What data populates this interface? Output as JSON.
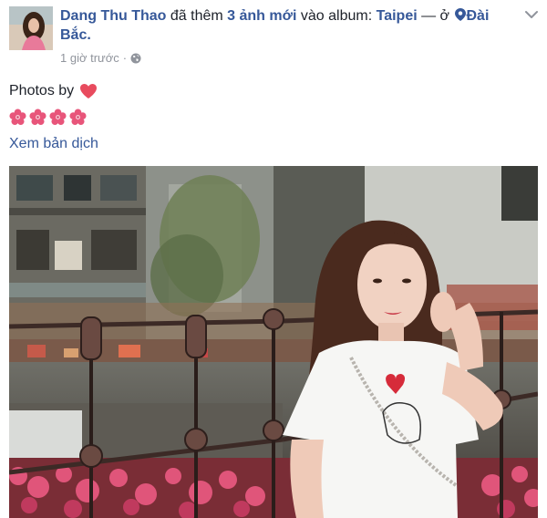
{
  "post": {
    "author": "Dang Thu Thao",
    "action": "đã thêm",
    "photo_count": "3 ảnh mới",
    "into_album": "vào album:",
    "album": "Taipei",
    "location_sep": "— ở",
    "location": "Đài Bắc.",
    "timestamp": "1 giờ trước",
    "dot": "·",
    "caption": "Photos by",
    "translate_link": "Xem bản dịch"
  },
  "icons": {
    "location": "map-pin-icon",
    "privacy": "globe-icon",
    "menu": "chevron-down-icon",
    "heart": "heart-emoji",
    "flower": "cherry-blossom-emoji"
  },
  "colors": {
    "link": "#365899",
    "text": "#1d2129",
    "meta": "#90949c",
    "heart": "#e84b5e",
    "flower": "#e8557a"
  }
}
